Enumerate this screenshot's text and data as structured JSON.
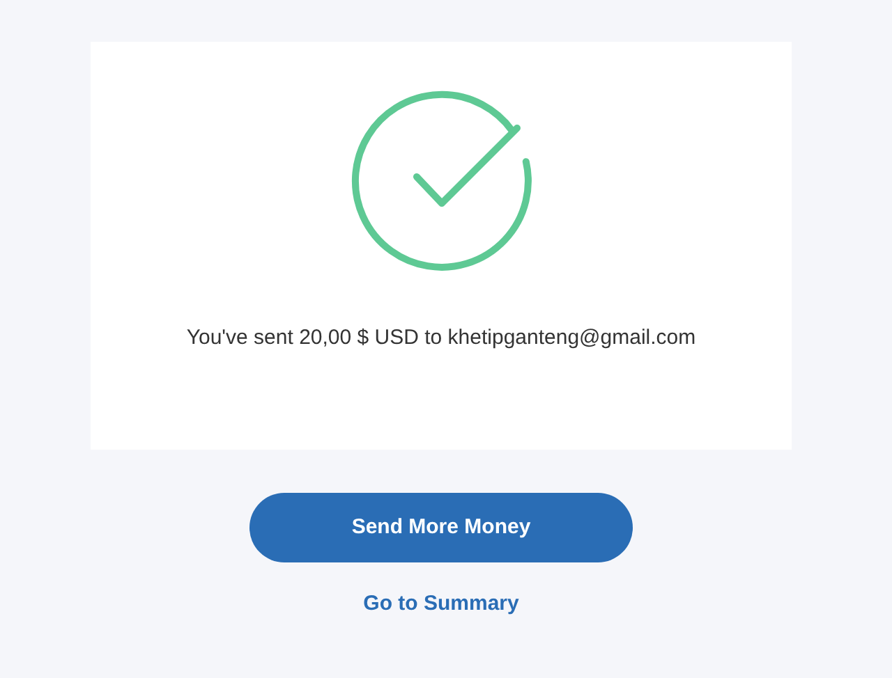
{
  "message": "You've sent 20,00 $ USD to khetipganteng@gmail.com",
  "primary_button": "Send More Money",
  "link": "Go to Summary"
}
